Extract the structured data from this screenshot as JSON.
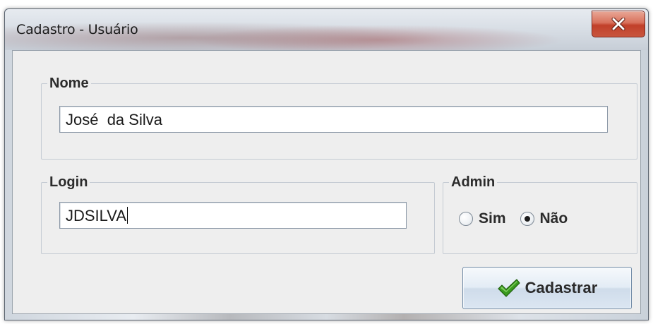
{
  "window": {
    "title": "Cadastro - Usuário",
    "close_icon": "close-x-icon"
  },
  "nome_group": {
    "legend": "Nome",
    "value": "José  da Silva"
  },
  "login_group": {
    "legend": "Login",
    "value": "JDSILVA"
  },
  "admin_group": {
    "legend": "Admin",
    "options": [
      {
        "label": "Sim",
        "selected": false
      },
      {
        "label": "Não",
        "selected": true
      }
    ]
  },
  "actions": {
    "submit_label": "Cadastrar",
    "submit_icon": "green-check-icon"
  },
  "colors": {
    "close_button": "#c8553d",
    "check_icon": "#3a9a1e"
  }
}
